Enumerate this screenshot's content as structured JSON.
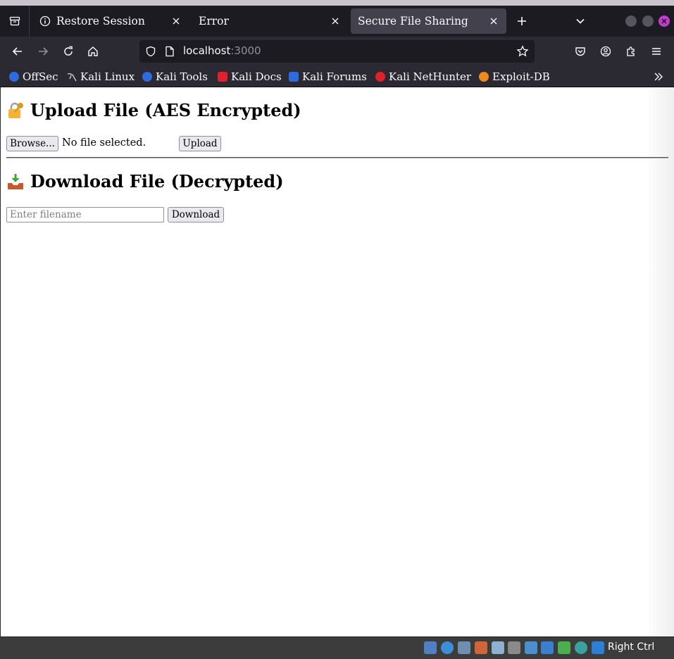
{
  "browser": {
    "tabs": [
      {
        "label": "Restore Session",
        "active": false
      },
      {
        "label": "Error",
        "active": false
      },
      {
        "label": "Secure File Sharing",
        "active": true
      }
    ],
    "url": {
      "host": "localhost",
      "port": ":3000"
    },
    "bookmarks": [
      {
        "label": "OffSec",
        "icon": "offsec-icon",
        "color": "#2d6cdf"
      },
      {
        "label": "Kali Linux",
        "icon": "kali-dragon-icon",
        "color": "#cfcfcf"
      },
      {
        "label": "Kali Tools",
        "icon": "kali-tools-icon",
        "color": "#2d6cdf"
      },
      {
        "label": "Kali Docs",
        "icon": "kali-docs-icon",
        "color": "#e0202a"
      },
      {
        "label": "Kali Forums",
        "icon": "kali-forums-icon",
        "color": "#2d6cdf"
      },
      {
        "label": "Kali NetHunter",
        "icon": "nethunter-icon",
        "color": "#e0202a"
      },
      {
        "label": "Exploit-DB",
        "icon": "exploitdb-icon",
        "color": "#f08a1c"
      }
    ]
  },
  "page": {
    "upload": {
      "heading": "Upload File (AES Encrypted)",
      "browse_label": "Browse...",
      "file_status": "No file selected.",
      "upload_label": "Upload"
    },
    "download": {
      "heading": "Download File (Decrypted)",
      "filename_placeholder": "Enter filename",
      "filename_value": "",
      "download_label": "Download"
    }
  },
  "statusbar": {
    "host_key_label": "Right Ctrl"
  },
  "colors": {
    "tabbar_bg": "#1c1b22",
    "toolbar_bg": "#2b2a33",
    "active_tab_bg": "#42414d",
    "close_button_accent": "#c43bd0"
  }
}
